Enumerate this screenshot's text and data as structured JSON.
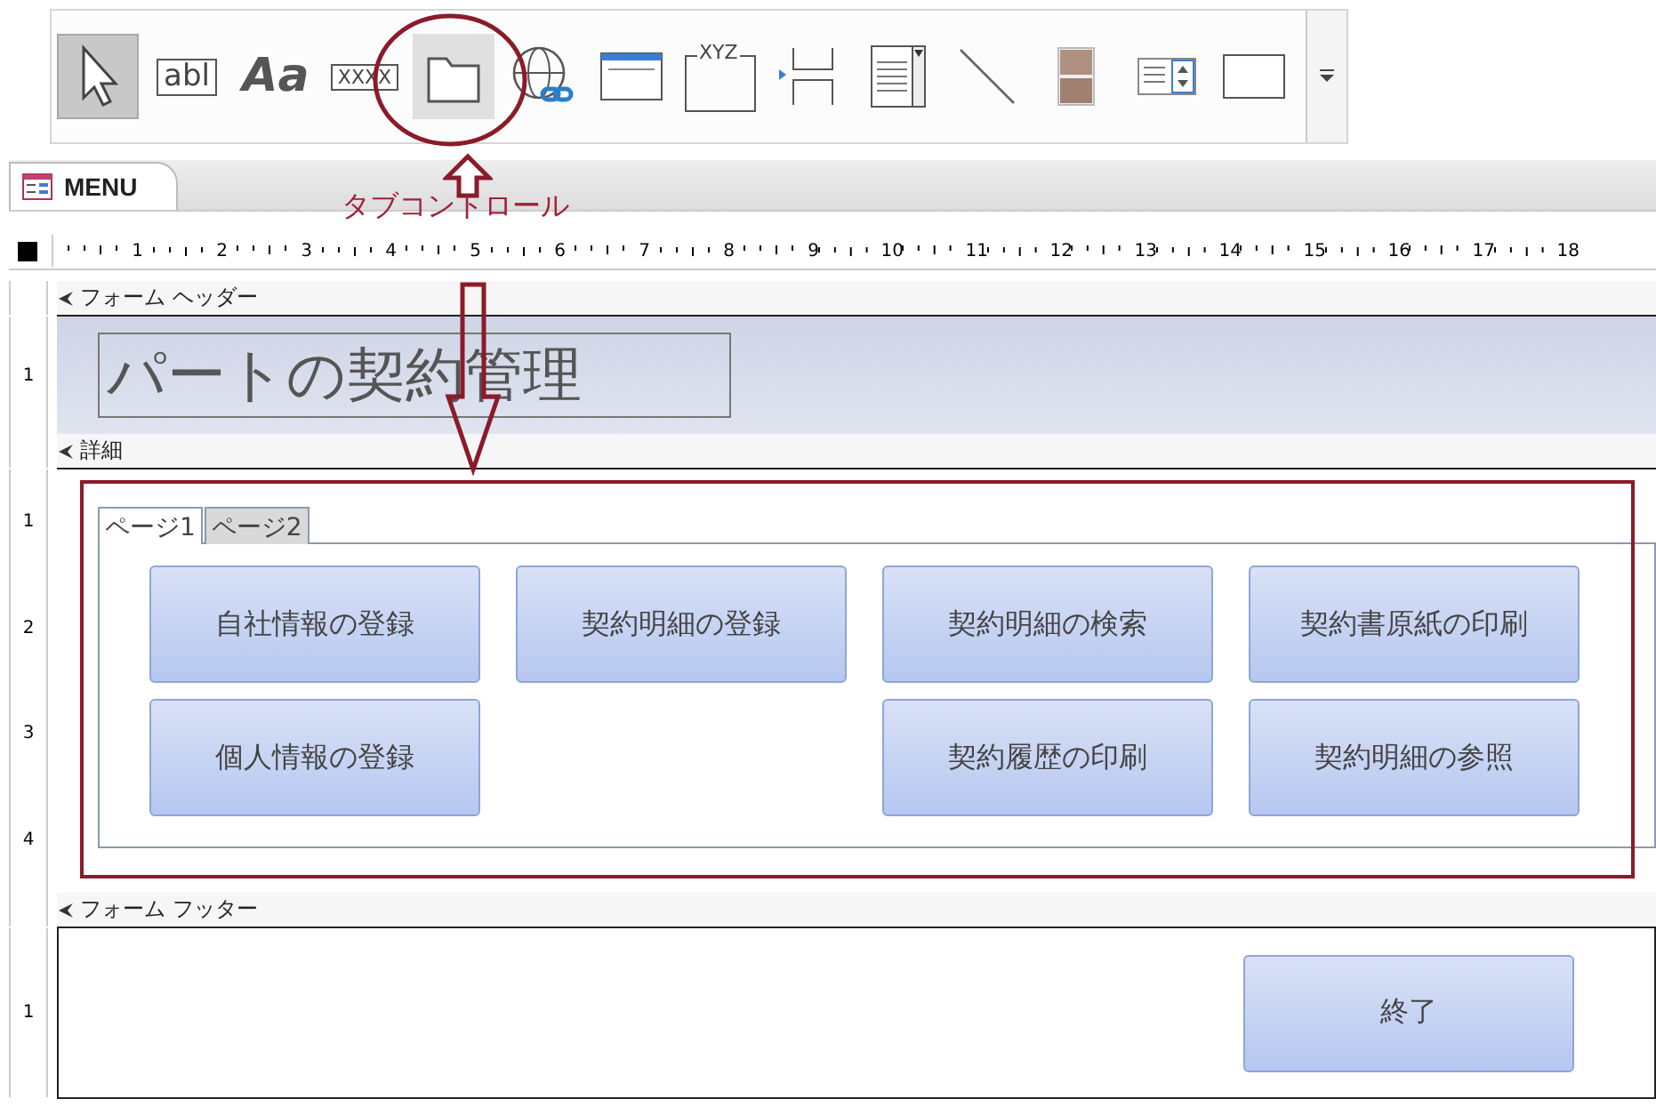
{
  "toolbar": {
    "tools": [
      {
        "kind": "pointer",
        "selected": true,
        "hovered": false
      },
      {
        "kind": "textbox",
        "label": "abl",
        "selected": false,
        "hovered": false
      },
      {
        "kind": "label",
        "label": "Aa",
        "selected": false,
        "hovered": false
      },
      {
        "kind": "button",
        "label": "XXXX",
        "selected": false,
        "hovered": false
      },
      {
        "kind": "tab",
        "selected": false,
        "hovered": true
      },
      {
        "kind": "hyperlink",
        "selected": false,
        "hovered": false
      },
      {
        "kind": "webbrowser",
        "selected": false,
        "hovered": false
      },
      {
        "kind": "frame",
        "label": "XYZ",
        "selected": false,
        "hovered": false
      },
      {
        "kind": "pagebreak",
        "selected": false,
        "hovered": false
      },
      {
        "kind": "combobox",
        "selected": false,
        "hovered": false
      },
      {
        "kind": "line",
        "selected": false,
        "hovered": false
      },
      {
        "kind": "toggle",
        "selected": false,
        "hovered": false
      },
      {
        "kind": "listbox",
        "selected": false,
        "hovered": false
      },
      {
        "kind": "rectangle",
        "selected": false,
        "hovered": false
      }
    ]
  },
  "document_tab": {
    "title": "MENU"
  },
  "ruler": {
    "labels": [
      "1",
      "2",
      "3",
      "4",
      "5",
      "6",
      "7",
      "8",
      "9",
      "10",
      "11",
      "12",
      "13",
      "14",
      "15",
      "16",
      "17",
      "18"
    ]
  },
  "sections": [
    {
      "kind": "header",
      "title": "フォーム ヘッダー",
      "ruler_labels": [
        "1"
      ],
      "label": "パートの契約管理"
    },
    {
      "kind": "detail",
      "title": "詳細",
      "ruler_labels": [
        "1",
        "2",
        "3",
        "4"
      ],
      "tabs": [
        {
          "label": "ページ1",
          "selected": true
        },
        {
          "label": "ページ2",
          "selected": false
        }
      ],
      "button_rows": [
        [
          "自社情報の登録",
          "契約明細の登録",
          "契約明細の検索",
          "契約書原紙の印刷"
        ],
        [
          "個人情報の登録",
          null,
          "契約履歴の印刷",
          "契約明細の参照"
        ]
      ]
    },
    {
      "kind": "footer",
      "title": "フォーム フッター",
      "ruler_labels": [
        "1"
      ],
      "button": "終了"
    }
  ],
  "annotation": {
    "label": "タブコントロール"
  }
}
